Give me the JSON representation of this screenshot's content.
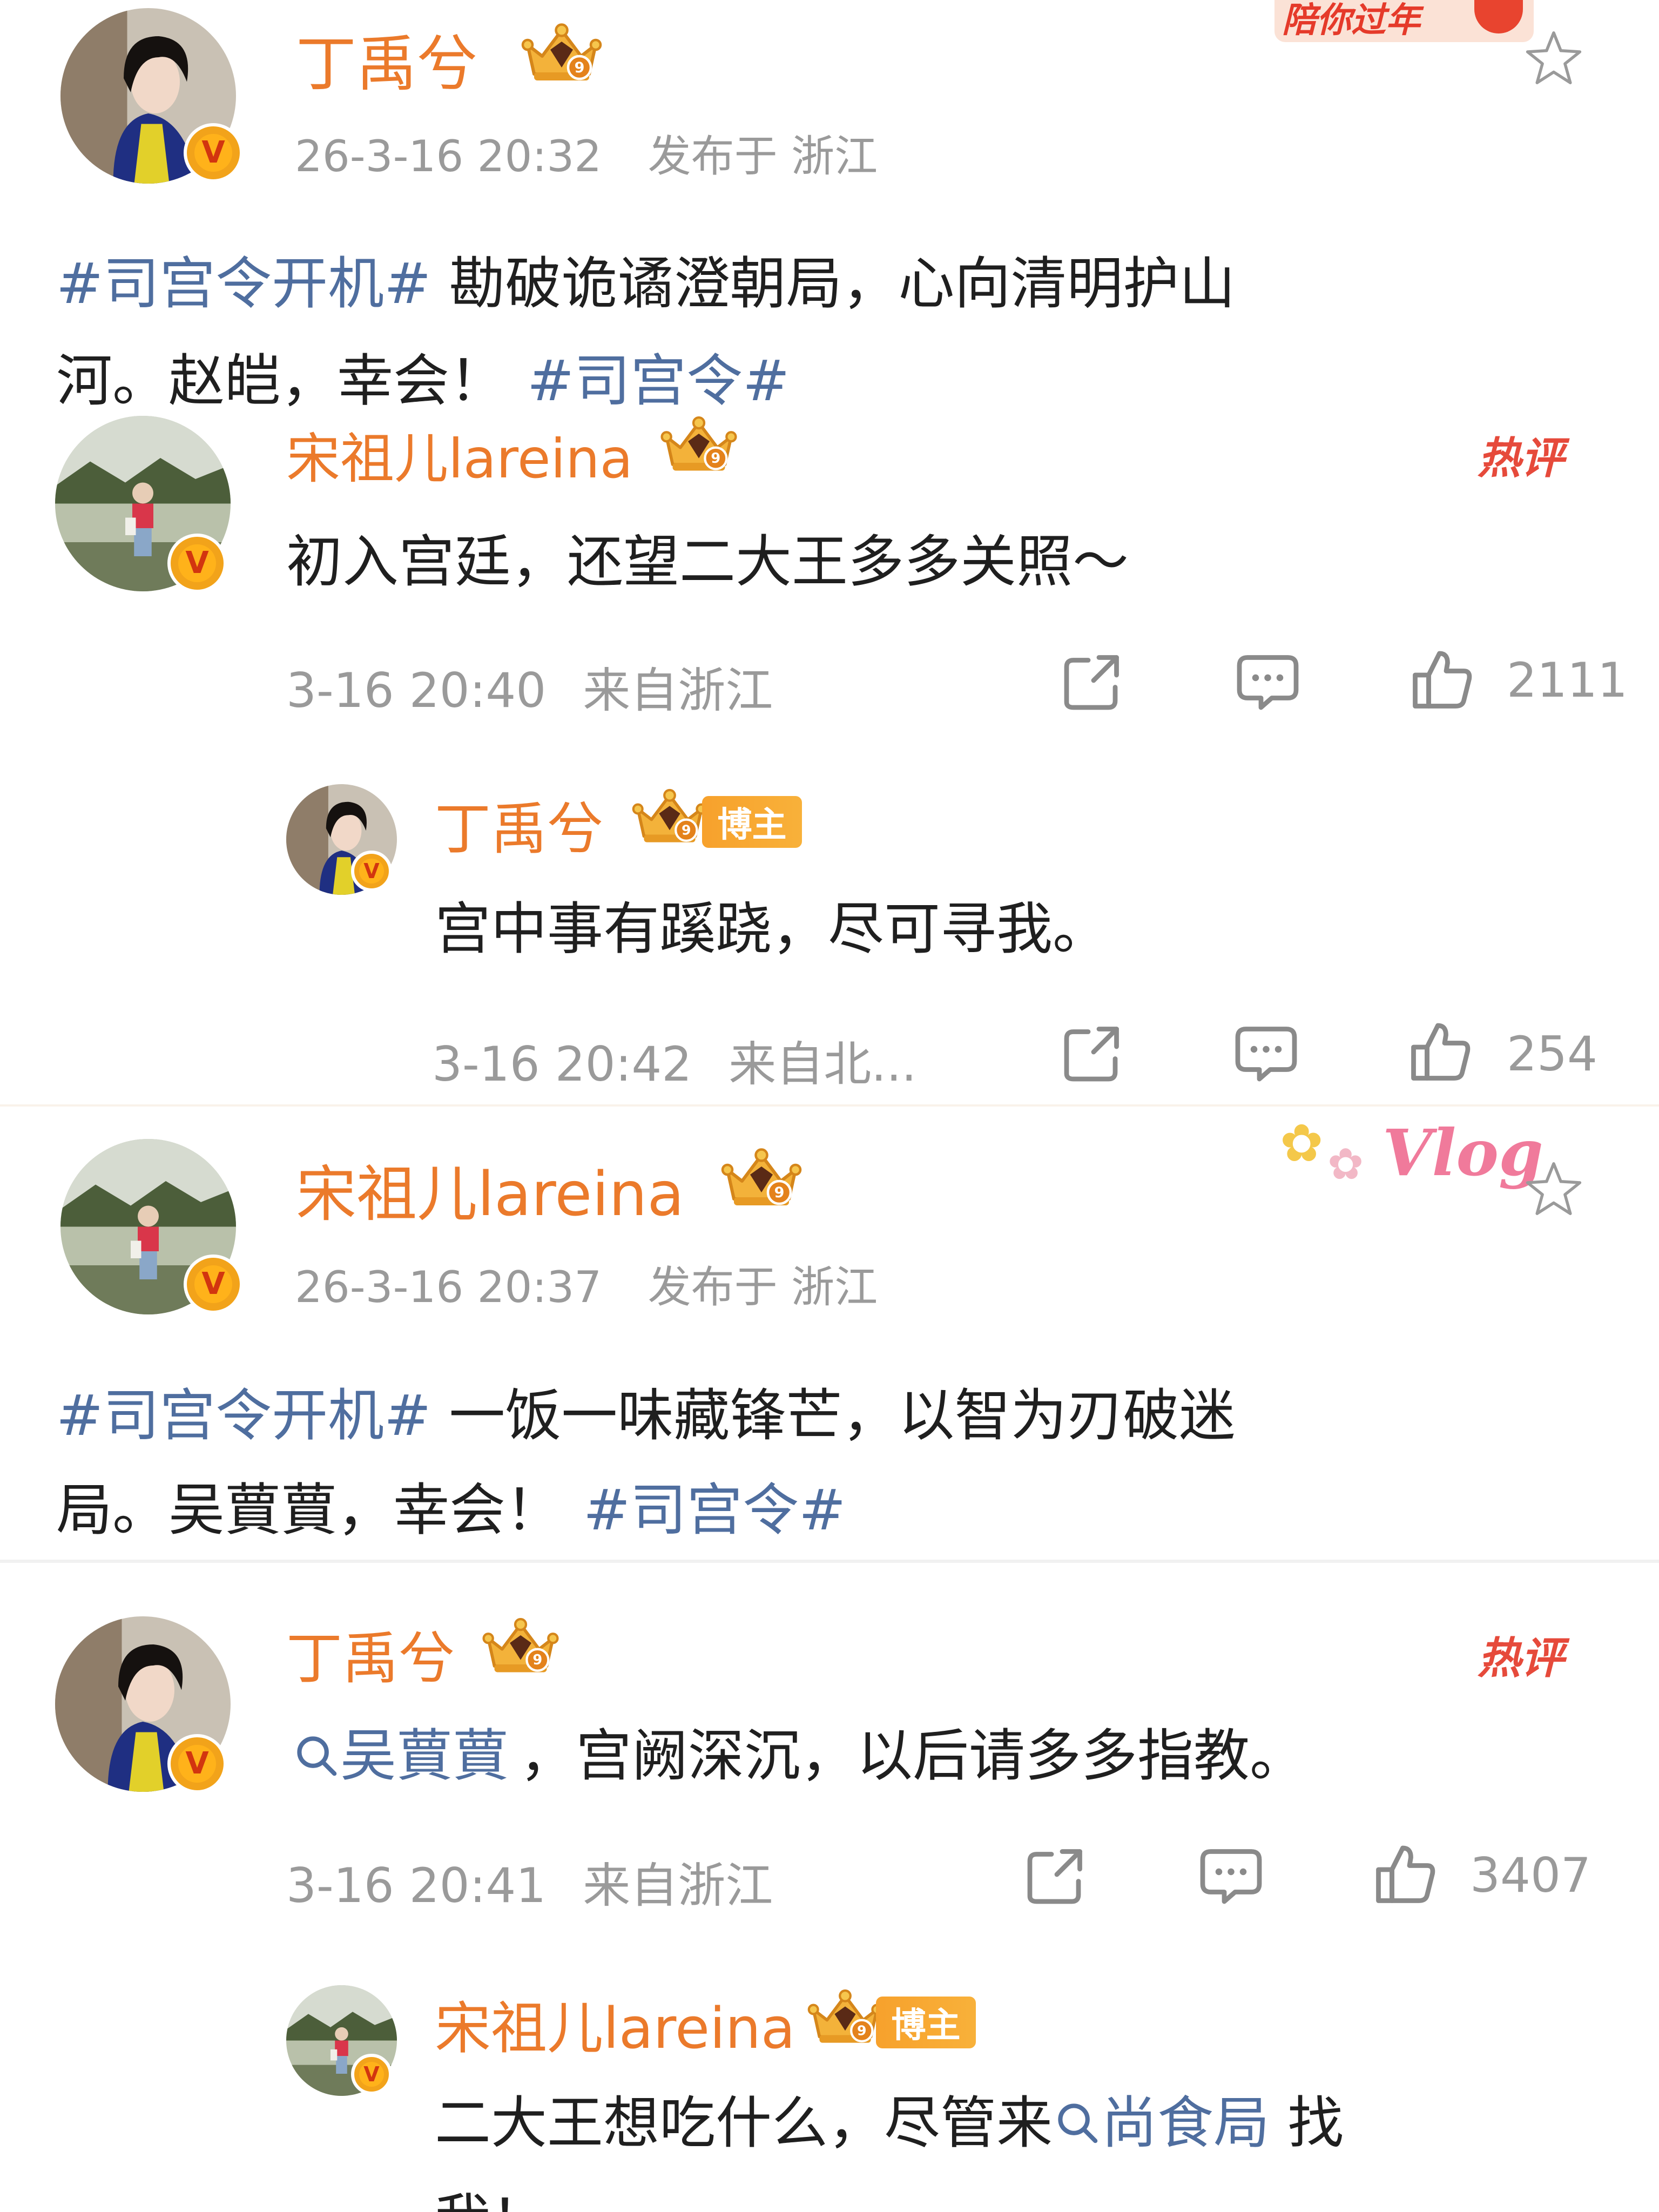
{
  "post1": {
    "author": "丁禹兮",
    "time": "26-3-16 20:32",
    "location": "发布于 浙江",
    "corner_sticker": "陪你过年",
    "text_line1": {
      "hashtag": "#司宫令开机#",
      "text": " 勘破诡谲澄朝局，心向清明护山"
    },
    "text_line2": {
      "text": "河。赵皑，幸会！",
      "hashtag": "#司宫令#"
    },
    "hot_comment": {
      "author": "宋祖儿lareina",
      "badge": "热评",
      "text": "初入宫廷，还望二大王多多关照～",
      "time": "3-16 20:40",
      "location": "来自浙江",
      "likes": "2111"
    },
    "reply": {
      "author": "丁禹兮",
      "badge": "博主",
      "text": "宫中事有蹊跷，尽可寻我。",
      "time": "3-16 20:42",
      "location": "来自北...",
      "likes": "254"
    }
  },
  "post2": {
    "author": "宋祖儿lareina",
    "time": "26-3-16 20:37",
    "location": "发布于 浙江",
    "corner_sticker": "Vlog",
    "text_line1": {
      "hashtag": "#司宫令开机#",
      "text": " 一饭一味藏锋芒，以智为刃破迷"
    },
    "text_line2": {
      "text": "局。吴蕒蕒，幸会！",
      "hashtag": "#司宫令#"
    },
    "hot_comment": {
      "author": "丁禹兮",
      "badge": "热评",
      "mention": "吴蕒蕒",
      "text": "，宫阙深沉，以后请多多指教。",
      "time": "3-16 20:41",
      "location": "来自浙江",
      "likes": "3407"
    },
    "reply": {
      "author": "宋祖儿lareina",
      "badge": "博主",
      "text_before": "二大王想吃什么，尽管来",
      "mention": "尚食局",
      "text_after": " 找",
      "text_line2": "我！"
    }
  },
  "icons": [
    "star-icon",
    "share-icon",
    "comment-icon",
    "like-icon",
    "crown-badge-icon",
    "verified-icon",
    "search-link-icon"
  ],
  "colors": {
    "name": "#eb7a2b",
    "hashtag": "#4f6e9f",
    "meta": "#9a9a9a",
    "hot": "#e64a3b",
    "bozhu": "#f7a12c"
  }
}
